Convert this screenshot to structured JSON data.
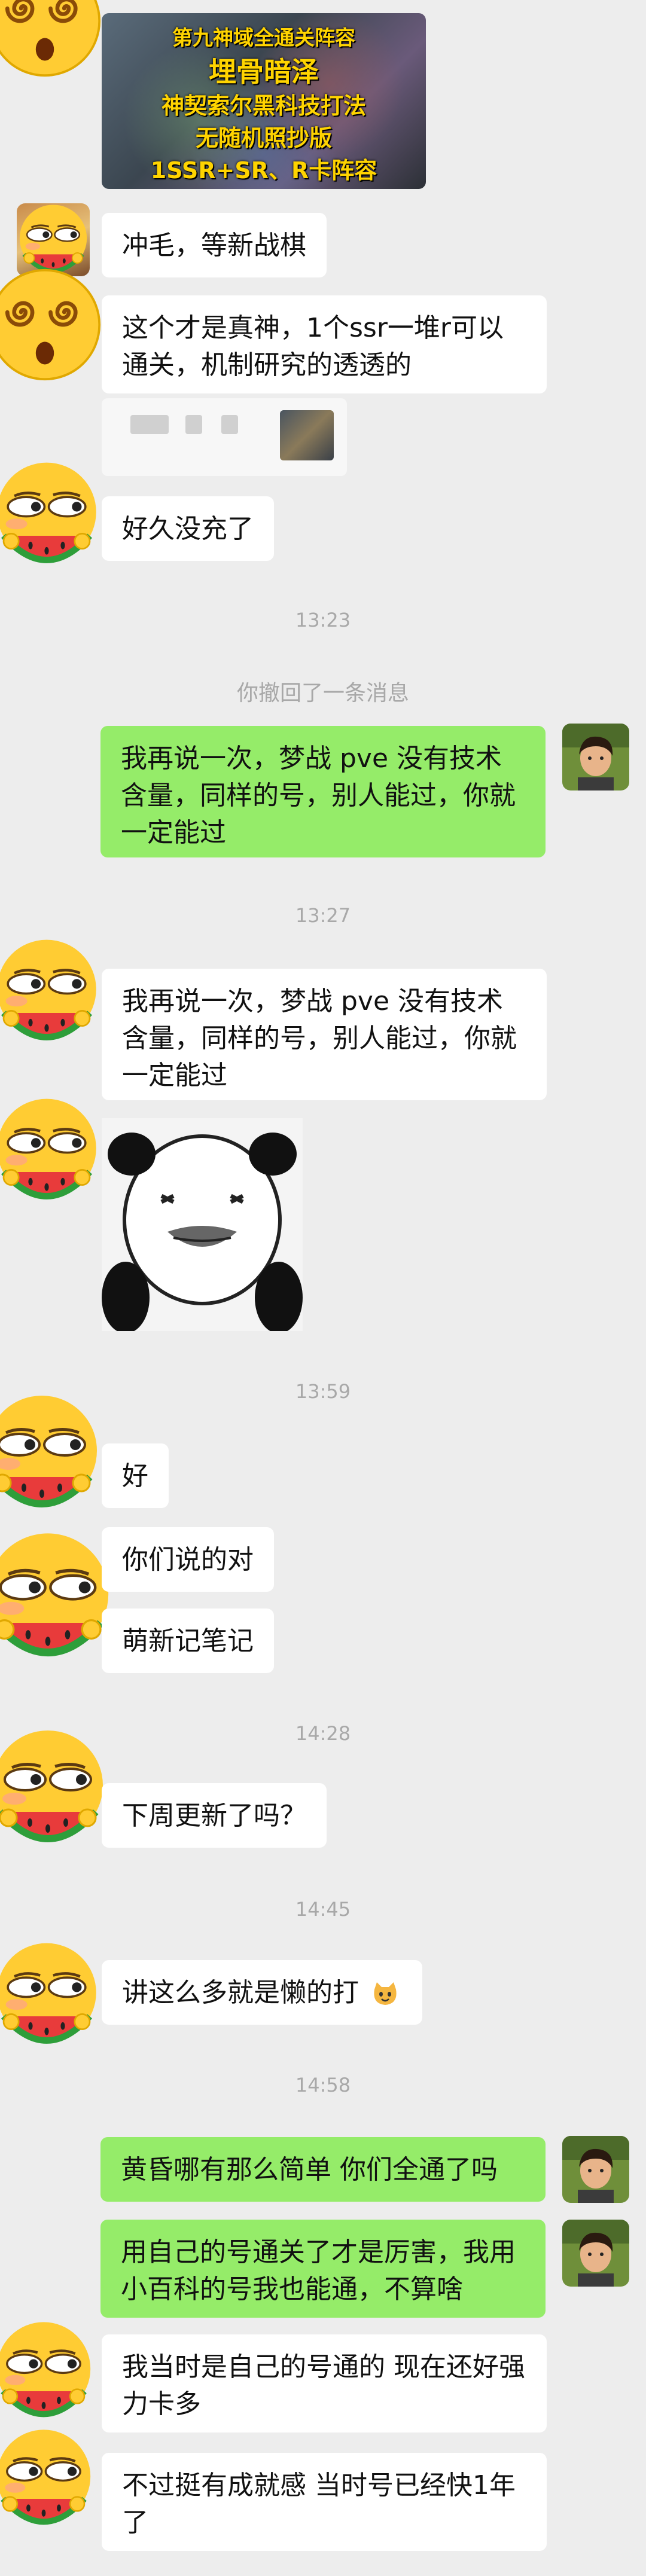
{
  "chat": {
    "colors": {
      "background": "#ededed",
      "incoming": "#ffffff",
      "outgoing": "#95ec69",
      "timestamp": "#a8a8a8"
    },
    "video_thumb": {
      "lines": [
        "第九神域全通关阵容",
        "埋骨暗泽",
        "神契索尔黑科技打法",
        "无随机照抄版",
        "1SSR+SR、R卡阵容"
      ]
    },
    "messages": [
      {
        "text": "冲毛，等新战棋"
      },
      {
        "text": "这个才是真神，1个ssr一堆r可以通关，机制研究的透透的"
      },
      {
        "text": "好久没充了"
      },
      {
        "text": "13:23"
      },
      {
        "text": "你撤回了一条消息"
      },
      {
        "text": "我再说一次，梦战 pve 没有技术含量，同样的号，别人能过，你就一定能过"
      },
      {
        "text": "13:27"
      },
      {
        "text": "我再说一次，梦战 pve 没有技术含量，同样的号，别人能过，你就一定能过"
      },
      {
        "text": "13:59"
      },
      {
        "text": "好"
      },
      {
        "text": "你们说的对"
      },
      {
        "text": "萌新记笔记"
      },
      {
        "text": "14:28"
      },
      {
        "text": "下周更新了吗？"
      },
      {
        "text": "14:45"
      },
      {
        "text": "讲这么多就是懒的打"
      },
      {
        "text": "14:58"
      },
      {
        "text": "黄昏哪有那么简单 你们全通了吗"
      },
      {
        "text": "用自己的号通关了才是厉害，我用小百科的号我也能通，不算啥"
      },
      {
        "text": "我当时是自己的号通的 现在还好强力卡多"
      },
      {
        "text": "不过挺有成就感 当时号已经快1年了"
      }
    ]
  }
}
